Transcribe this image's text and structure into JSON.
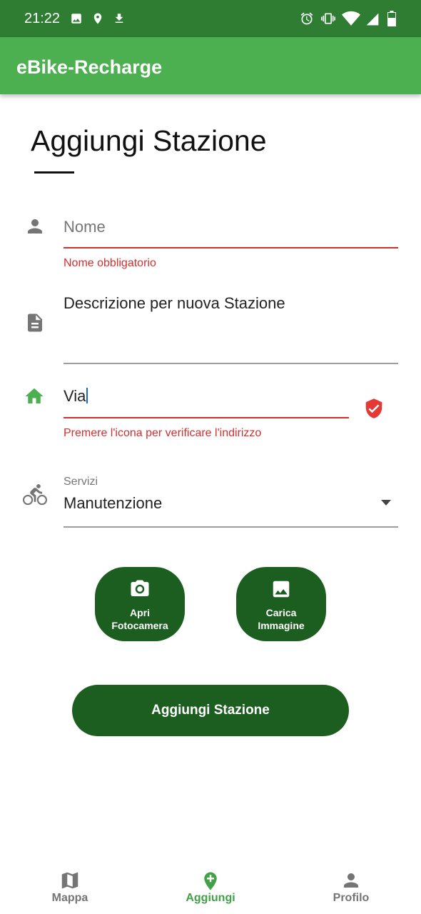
{
  "status_bar": {
    "time": "21:22",
    "icons": [
      "image-icon",
      "location-pin-icon",
      "download-icon",
      "alarm-icon",
      "vibrate-icon",
      "wifi-icon",
      "signal-icon",
      "battery-icon"
    ]
  },
  "app_bar": {
    "title": "eBike-Recharge"
  },
  "page": {
    "title": "Aggiungi Stazione"
  },
  "form": {
    "name": {
      "placeholder": "Nome",
      "value": "",
      "error": "Nome obbligatorio"
    },
    "description": {
      "value": "Descrizione per nuova Stazione"
    },
    "street": {
      "value": "Via",
      "error": "Premere l'icona per verificare l'indirizzo"
    },
    "services": {
      "label": "Servizi",
      "selected": "Manutenzione"
    }
  },
  "buttons": {
    "camera": "Apri\nFotocamera",
    "upload": "Carica\nImmagine",
    "submit": "Aggiungi Stazione"
  },
  "bottom_nav": {
    "items": [
      {
        "label": "Mappa",
        "icon": "map-icon",
        "active": false
      },
      {
        "label": "Aggiungi",
        "icon": "add-location-icon",
        "active": true
      },
      {
        "label": "Profilo",
        "icon": "person-icon",
        "active": false
      }
    ]
  },
  "colors": {
    "status_bar": "#2e7d32",
    "app_bar": "#4caf50",
    "primary_dark": "#1b5e20",
    "error": "#d32f2f",
    "nav_active": "#43a047",
    "nav_inactive": "#757575"
  }
}
